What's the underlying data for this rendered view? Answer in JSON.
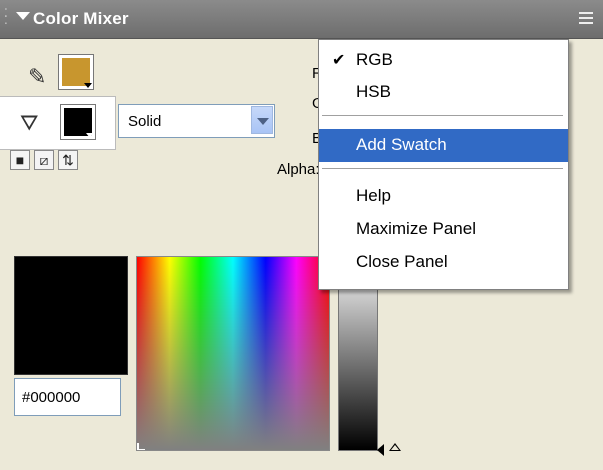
{
  "panel": {
    "title": "Color Mixer"
  },
  "stroke": {
    "color": "#c8962e"
  },
  "fill": {
    "color": "#000000",
    "type": "Solid"
  },
  "labels": {
    "r": "R",
    "g": "G",
    "b": "B",
    "alpha": "Alpha:"
  },
  "preview": {
    "hex": "#000000"
  },
  "context_menu": {
    "items": [
      {
        "label": "RGB",
        "checked": true
      },
      {
        "label": "HSB",
        "checked": false
      },
      {
        "label": "Add Swatch",
        "highlighted": true
      },
      {
        "label": "Help"
      },
      {
        "label": "Maximize Panel"
      },
      {
        "label": "Close Panel"
      }
    ]
  },
  "icons": {
    "stroke": "pencil-icon",
    "fill": "paint-bucket-icon",
    "black_white": "black-white-icon",
    "no_color": "no-color-icon",
    "swap": "swap-colors-icon",
    "panel_options": "panel-options-icon",
    "collapse": "collapse-arrow-icon",
    "check": "checkmark-icon"
  },
  "colors": {
    "menu_highlight": "#316ac5",
    "panel_bg": "#ece9d8",
    "titlebar": "#7a7a7a"
  }
}
